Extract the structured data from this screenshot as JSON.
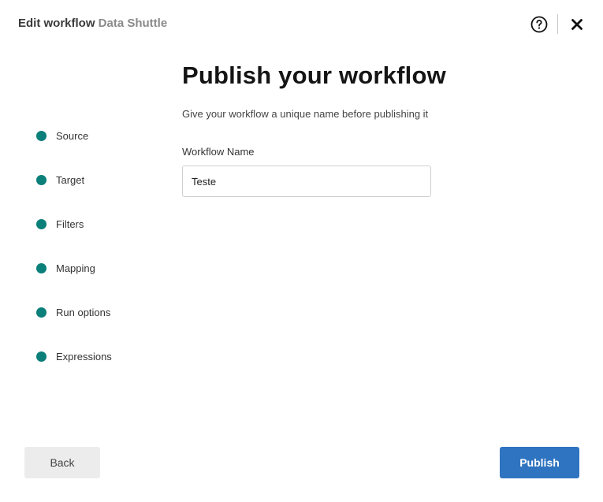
{
  "header": {
    "title": "Edit workflow",
    "app_name": "Data Shuttle",
    "help_icon": "question-circle-icon",
    "close_icon": "close-x-icon"
  },
  "steps": [
    {
      "label": "Source"
    },
    {
      "label": "Target"
    },
    {
      "label": "Filters"
    },
    {
      "label": "Mapping"
    },
    {
      "label": "Run options"
    },
    {
      "label": "Expressions"
    }
  ],
  "main": {
    "title": "Publish your workflow",
    "subtitle": "Give your workflow a unique name before publishing it",
    "field_label": "Workflow Name",
    "field_value": "Teste"
  },
  "footer": {
    "back_label": "Back",
    "publish_label": "Publish"
  },
  "colors": {
    "step_dot": "#0b7f7a",
    "primary_button": "#2f74c0",
    "secondary_button": "#ececec"
  }
}
